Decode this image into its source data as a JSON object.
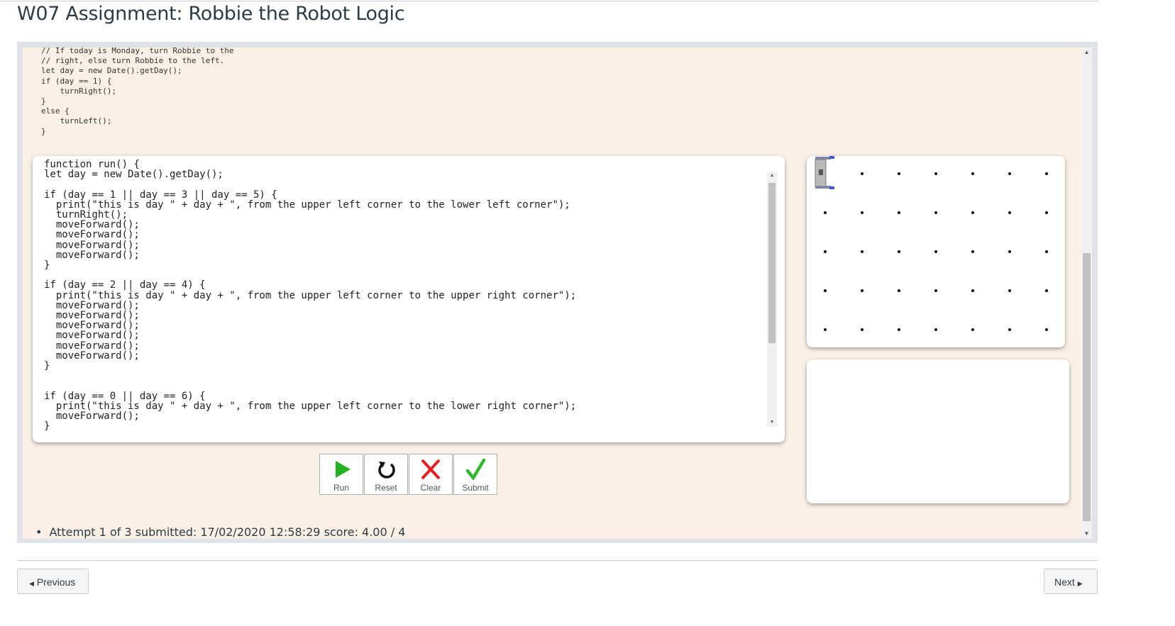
{
  "page": {
    "title": "W07 Assignment: Robbie the Robot Logic"
  },
  "description_code": "// If today is Monday, turn Robbie to the\n// right, else turn Robbie to the left.\nlet day = new Date().getDay();\nif (day == 1) {\n    turnRight();\n}\nelse {\n    turnLeft();\n}",
  "editor": {
    "code": "function run() {\nlet day = new Date().getDay();\n\nif (day == 1 || day == 3 || day == 5) {\n  print(\"this is day \" + day + \", from the upper left corner to the lower left corner\");\n  turnRight();\n  moveForward();\n  moveForward();\n  moveForward();\n  moveForward();\n}\n\nif (day == 2 || day == 4) {\n  print(\"this is day \" + day + \", from the upper left corner to the upper right corner\");\n  moveForward();\n  moveForward();\n  moveForward();\n  moveForward();\n  moveForward();\n  moveForward();\n}\n\n\nif (day == 0 || day == 6) {\n  print(\"this is day \" + day + \", from the upper left corner to the lower right corner\");\n  moveForward();\n}"
  },
  "grid": {
    "rows": 5,
    "cols": 7,
    "robot_position": {
      "row": 0,
      "col": 0
    }
  },
  "toolbar": {
    "run_label": "Run",
    "reset_label": "Reset",
    "clear_label": "Clear",
    "submit_label": "Submit"
  },
  "attempts": [
    "Attempt 1 of 3 submitted: 17/02/2020 12:58:29 score: 4.00 / 4"
  ],
  "nav": {
    "previous_label": "Previous",
    "next_label": "Next"
  },
  "colors": {
    "run": "#22b322",
    "clear": "#e81c1c",
    "submit": "#2eb82e",
    "panel_bg": "#faf0e6"
  }
}
